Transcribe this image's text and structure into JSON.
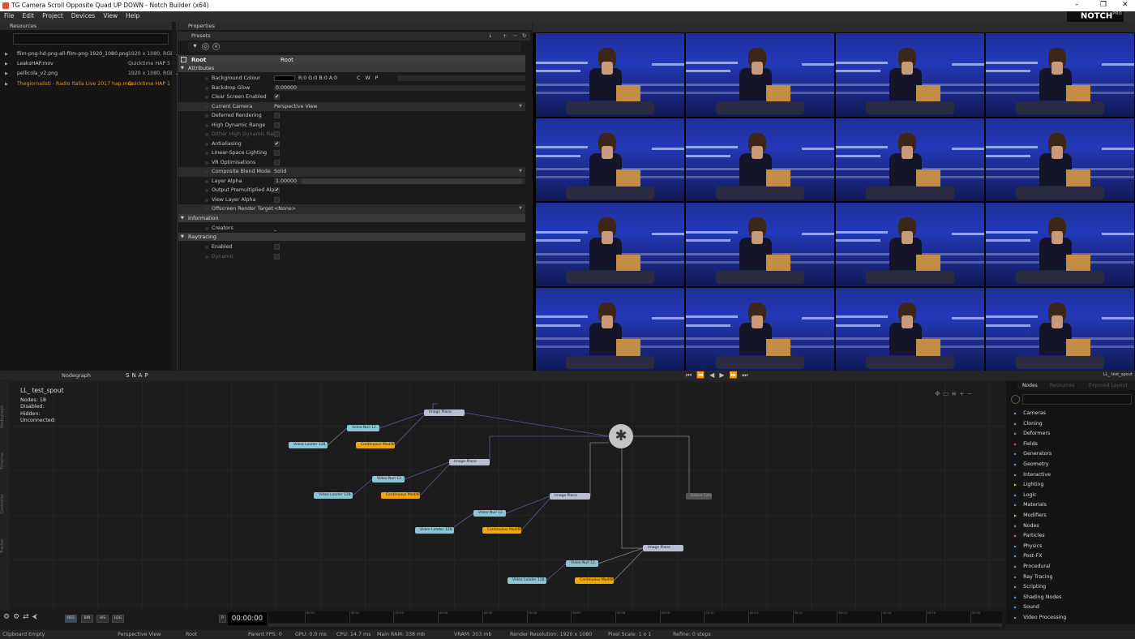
{
  "window": {
    "title": "TG Camera Scroll Opposite Quad UP DOWN - Notch Builder (x64)"
  },
  "menu": [
    "File",
    "Edit",
    "Project",
    "Devices",
    "View",
    "Help"
  ],
  "logo": {
    "text": "NOTCH",
    "badge": "PRO"
  },
  "resources": {
    "header": "Resources",
    "items": [
      {
        "name": "film-png-hd-png-all-film-png-1920_1080.png",
        "info": "1920 x 1080, RGB/..",
        "selected": false
      },
      {
        "name": "LeaksHAP.mov",
        "info": "Quicktime HAP 5",
        "selected": false
      },
      {
        "name": "pellicola_v2.png",
        "info": "1920 x 1080, RGB/..",
        "selected": false
      },
      {
        "name": "Thegiornalisti - Radio Italia Live 2017 hap.mov",
        "info": "Quicktime HAP 1",
        "selected": true
      }
    ]
  },
  "properties": {
    "header": "Properties",
    "presets_label": "Presets",
    "root": {
      "label": "Root",
      "value": "Root"
    },
    "sections": [
      {
        "title": "Attributes",
        "rows": [
          {
            "label": "Background Colour",
            "value": "R:0 G:0 B:0 A:0",
            "extra": "C   W   P",
            "type": "colour"
          },
          {
            "label": "Backdrop Glow",
            "value": "0.00000",
            "type": "slider"
          },
          {
            "label": "Clear Screen Enabled",
            "value": "✔",
            "type": "check"
          },
          {
            "label": "Current Camera",
            "value": "Perspective View",
            "type": "dropdown"
          },
          {
            "label": "Deferred Rendering",
            "value": "",
            "type": "check"
          },
          {
            "label": "High Dynamic Range",
            "value": "",
            "type": "check"
          },
          {
            "label": "Dither High Dynamic Ran",
            "value": "",
            "type": "check",
            "dim": true
          },
          {
            "label": "Antialiasing",
            "value": "✔",
            "type": "check"
          },
          {
            "label": "Linear-Space Lighting",
            "value": "",
            "type": "check"
          },
          {
            "label": "VR Optimisations",
            "value": "",
            "type": "check"
          },
          {
            "label": "Composite Blend Mode",
            "value": "Solid",
            "type": "dropdown"
          },
          {
            "label": "Layer Alpha",
            "value": "1.00000",
            "type": "slider"
          },
          {
            "label": "Output Premultiplied Alpl",
            "value": "✔",
            "type": "check"
          },
          {
            "label": "View Layer Alpha",
            "value": "",
            "type": "check"
          },
          {
            "label": "Offscreen Render Target",
            "value": "<None>",
            "type": "dropdown"
          }
        ]
      },
      {
        "title": "Information",
        "rows": [
          {
            "label": "Creators",
            "value": "_",
            "type": "text"
          }
        ]
      },
      {
        "title": "Raytracing",
        "rows": [
          {
            "label": "Enabled",
            "value": "",
            "type": "check"
          },
          {
            "label": "Dynamic",
            "value": "",
            "type": "check",
            "dim": true
          }
        ]
      }
    ]
  },
  "nodegraph": {
    "tab_label": "Nodegraph",
    "toolbar_snap": "SNAP",
    "layer_name": "LL_ test_spout",
    "stats": [
      {
        "label": "Nodes:",
        "value": "18"
      },
      {
        "label": "Disabled:",
        "value": ""
      },
      {
        "label": "Hidden:",
        "value": ""
      },
      {
        "label": "Unconnected:",
        "value": ""
      }
    ],
    "side_tabs": [
      "Nodegraph",
      "Timeline",
      "Controller",
      "Tracker"
    ],
    "nodes": [
      {
        "label": "Image Plane",
        "kind": "grey"
      },
      {
        "label": "Video Null 12..",
        "kind": "blue"
      },
      {
        "label": "Video Loader 128..",
        "kind": "blue"
      },
      {
        "label": "Continuous Modifier",
        "kind": "orange"
      },
      {
        "label": "Image Plane",
        "kind": "grey"
      },
      {
        "label": "Video Null 12..",
        "kind": "blue"
      },
      {
        "label": "Video Loader 128..",
        "kind": "blue"
      },
      {
        "label": "Continuous Modifier",
        "kind": "orange"
      },
      {
        "label": "Image Plane",
        "kind": "grey"
      },
      {
        "label": "Video Null 12..",
        "kind": "blue"
      },
      {
        "label": "Video Loader 128..",
        "kind": "blue"
      },
      {
        "label": "Continuous Modifier",
        "kind": "orange"
      },
      {
        "label": "Image Plane",
        "kind": "grey"
      },
      {
        "label": "Video Null 12..",
        "kind": "blue"
      },
      {
        "label": "Video Loader 128..",
        "kind": "blue"
      },
      {
        "label": "Continuous Modifier",
        "kind": "orange"
      },
      {
        "label": "Colour Corr..",
        "kind": "dark"
      }
    ]
  },
  "nodes_panel": {
    "tabs": [
      "Nodes",
      "Resources",
      "Exposed Layout"
    ],
    "layer_tag": "LL_ test_spout",
    "categories": [
      "Cameras",
      "Cloning",
      "Deformers",
      "Fields",
      "Generators",
      "Geometry",
      "Interactive",
      "Lighting",
      "Logic",
      "Materials",
      "Modifiers",
      "Nodes",
      "Particles",
      "Physics",
      "Post-FX",
      "Procedural",
      "Ray Tracing",
      "Scripting",
      "Shading Nodes",
      "Sound",
      "Video Processing"
    ]
  },
  "timeline": {
    "time": "00:00:00",
    "buttons": [
      "RES",
      "BIN",
      "HIS",
      "LOG"
    ],
    "ticks": [
      "00:01",
      "00:02",
      "00:03",
      "00:04",
      "00:05",
      "00:06",
      "00:07",
      "00:08",
      "00:09",
      "00:10",
      "00:11",
      "00:12",
      "00:13",
      "00:14",
      "00:15",
      "00:16"
    ]
  },
  "status": {
    "clipboard": "Clipboard Empty",
    "view": "Perspective View",
    "layer": "Root",
    "parent_fps": "Parent  FPS: 0",
    "gpu": "GPU: 0.0 ms",
    "cpu": "CPU: 14.7 ms",
    "ram": "Main RAM: 338 mb",
    "vram": "VRAM: 303 mb",
    "render_res": "Render Resolution: 1920 x 1080",
    "pixel_scale": "Pixel Scale: 1 x 1",
    "refine": "Refine: 0 steps"
  },
  "colors": {
    "selected_resource": "#e8951e",
    "video_node": "#8ec5d6",
    "plane_node": "#b8bfd0",
    "modifier_node": "#f1a611"
  }
}
